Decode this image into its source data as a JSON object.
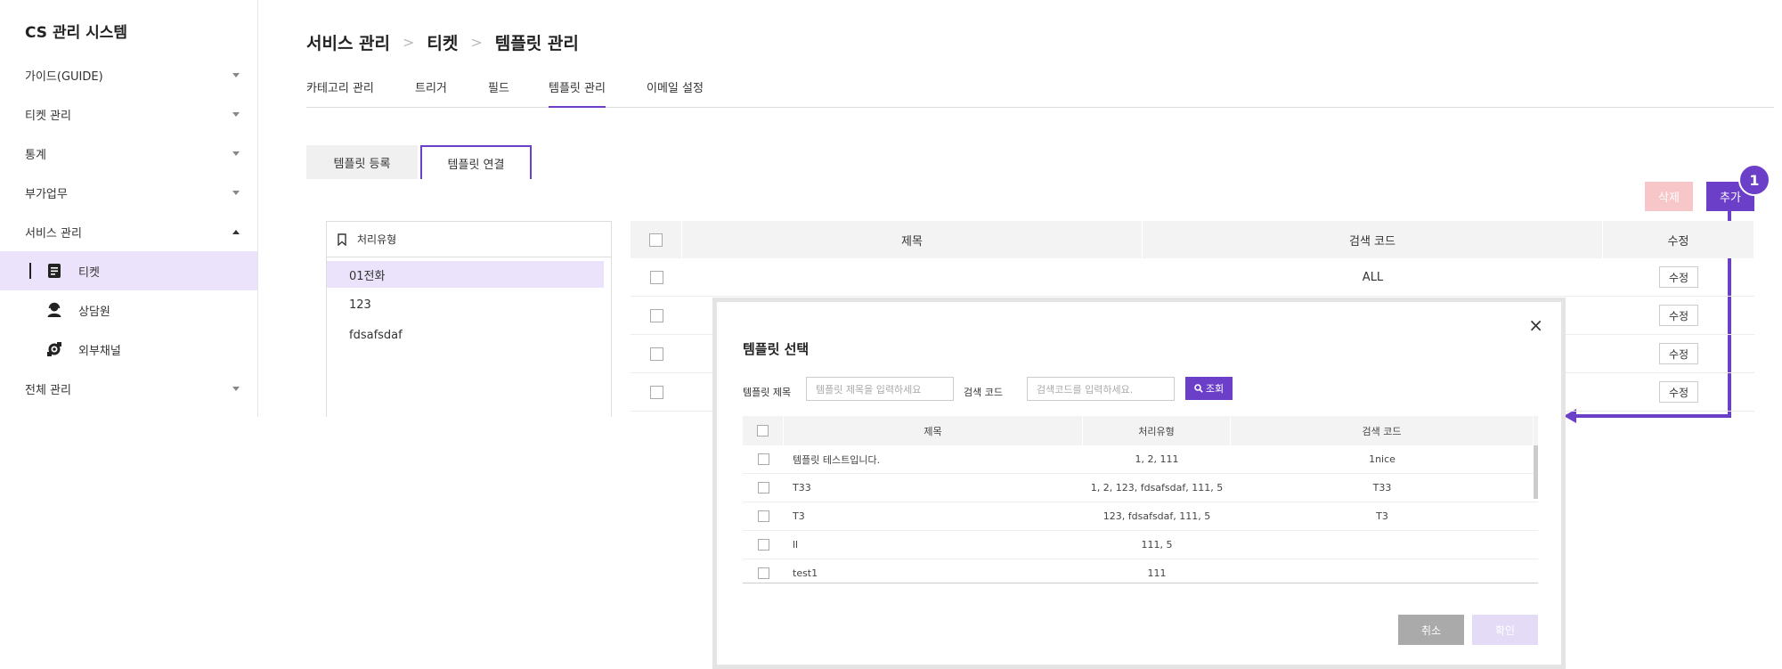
{
  "app_title": "CS 관리 시스템",
  "sidebar": {
    "items": [
      {
        "label": "가이드(GUIDE)"
      },
      {
        "label": "티켓 관리"
      },
      {
        "label": "통계"
      },
      {
        "label": "부가업무"
      },
      {
        "label": "서비스 관리"
      }
    ],
    "sub_items": [
      {
        "label": "티켓",
        "icon": "ticket-icon"
      },
      {
        "label": "상담원",
        "icon": "agent-icon"
      },
      {
        "label": "외부채널",
        "icon": "external-channel-icon"
      }
    ],
    "last_item": {
      "label": "전체 관리"
    }
  },
  "breadcrumb": [
    "서비스 관리",
    "티켓",
    "템플릿 관리"
  ],
  "tabs": [
    "카테고리 관리",
    "트리거",
    "필드",
    "템플릿 관리",
    "이메일 설정"
  ],
  "active_tab": "템플릿 관리",
  "subtabs": [
    "템플릿 등록",
    "템플릿 연결"
  ],
  "active_subtab": "템플릿 연결",
  "type_panel": {
    "header": "처리유형",
    "items": [
      "01전화",
      "123",
      "fdsafsdaf"
    ],
    "selected": "01전화"
  },
  "actions": {
    "delete": "삭제",
    "add": "추가",
    "step": "1"
  },
  "main_table": {
    "columns": [
      "제목",
      "검색 코드",
      "수정"
    ],
    "rows": [
      {
        "title": "",
        "code": "ALL",
        "edit": "수정"
      },
      {
        "title": "",
        "code": "",
        "edit": "수정"
      },
      {
        "title": "",
        "code": "",
        "edit": "수정"
      },
      {
        "title": "",
        "code": "",
        "edit": "수정"
      }
    ]
  },
  "modal": {
    "title": "템플릿 선택",
    "close": "×",
    "title_label": "템플릿 제목",
    "title_placeholder": "템플릿 제목을 입력하세요",
    "code_label": "검색 코드",
    "code_placeholder": "검색코드를 입력하세요.",
    "search_button": "조회",
    "columns": [
      "제목",
      "처리유형",
      "검색 코드"
    ],
    "rows": [
      {
        "title": "템플릿 테스트입니다.",
        "type": "1, 2, 111",
        "code": "1nice"
      },
      {
        "title": "T33",
        "type": "1, 2, 123, fdsafsdaf, 111, 5",
        "code": "T33"
      },
      {
        "title": "T3",
        "type": "123, fdsafsdaf, 111, 5",
        "code": "T3"
      },
      {
        "title": "ll",
        "type": "111, 5",
        "code": ""
      },
      {
        "title": "test1",
        "type": "111",
        "code": ""
      }
    ],
    "cancel": "취소",
    "confirm": "확인"
  },
  "colors": {
    "accent": "#6c3fc9",
    "active_bg": "#ebe3fb",
    "delete": "#f6c6c8"
  }
}
